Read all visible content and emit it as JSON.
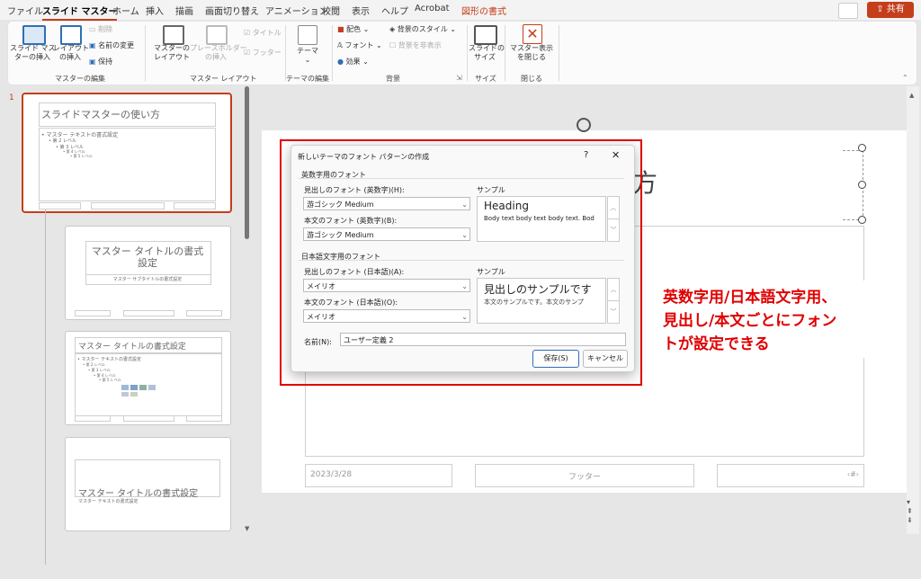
{
  "tabs": [
    "ファイル",
    "スライド マスター",
    "ホーム",
    "挿入",
    "描画",
    "画面切り替え",
    "アニメーション",
    "校閲",
    "表示",
    "ヘルプ",
    "Acrobat",
    "図形の書式"
  ],
  "share_label": "共有",
  "ribbon": {
    "insert_master": [
      "スライド マス",
      "ターの挿入"
    ],
    "insert_layout": [
      "レイアウト",
      "の挿入"
    ],
    "delete": "削除",
    "rename": "名前の変更",
    "preserve": "保持",
    "group_edit_master": "マスターの編集",
    "master_layout": [
      "マスターの",
      "レイアウト"
    ],
    "insert_placeholder": [
      "プレースホルダー",
      "の挿入"
    ],
    "title_check": "タイトル",
    "footer_check": "フッター",
    "group_master_layout": "マスター レイアウト",
    "theme": "テーマ",
    "group_edit_theme": "テーマの編集",
    "colors": "配色",
    "fonts": "フォント",
    "effects": "効果",
    "bg_style": "背景のスタイル",
    "hide_bg": "背景を非表示",
    "group_background": "背景",
    "slide_size": [
      "スライドの",
      "サイズ"
    ],
    "group_size": "サイズ",
    "close_master": [
      "マスター表示",
      "を閉じる"
    ],
    "group_close": "閉じる"
  },
  "thumbs": {
    "number": "1",
    "master_title": "スライドマスターの使い方",
    "master_levels": [
      "• マスター テキストの書式設定",
      "• 第 2 レベル",
      "• 第 3 レベル",
      "• 第 4 レベル",
      "• 第 5 レベル"
    ],
    "t2_title": "マスター タイトルの書式設定",
    "t2_sub": "マスター サブタイトルの書式設定",
    "t3_title": "マスター タイトルの書式設定",
    "t3_levels": [
      "• マスター テキストの書式設定",
      "• 第 2 レベル",
      "• 第 3 レベル",
      "• 第 4 レベル",
      "• 第 5 レベル"
    ],
    "t4_title": "マスター タイトルの書式設定",
    "t4_sub": "マスター テキストの書式設定"
  },
  "slide": {
    "title_visible": "方",
    "date": "2023/3/28",
    "footer": "フッター",
    "pagenum": "‹#›"
  },
  "dialog": {
    "title": "新しいテーマのフォント パターンの作成",
    "help": "?",
    "close": "✕",
    "latin_section": "英数字用のフォント",
    "latin_heading_label": "見出しのフォント (英数字)(H):",
    "latin_heading_value": "游ゴシック Medium",
    "latin_body_label": "本文のフォント (英数字)(B):",
    "latin_body_value": "游ゴシック Medium",
    "sample_label": "サンプル",
    "latin_sample_heading": "Heading",
    "latin_sample_body": "Body text body text body text. Bod",
    "ea_section": "日本語文字用のフォント",
    "ea_heading_label": "見出しのフォント (日本語)(A):",
    "ea_heading_value": "メイリオ",
    "ea_body_label": "本文のフォント (日本語)(O):",
    "ea_body_value": "メイリオ",
    "sample_label2": "サンプル",
    "ea_sample_heading": "見出しのサンプルです",
    "ea_sample_body": "本文のサンプルです。本文のサンプ",
    "name_label": "名前(N):",
    "name_value": "ユーザー定義 2",
    "save": "保存(S)",
    "cancel": "キャンセル"
  },
  "annotation": [
    "英数字用/日本語文字用、",
    "見出し/本文ごとにフォン",
    "トが設定できる"
  ],
  "colors": {
    "accent": "#c43e1c",
    "highlight": "#e00000"
  }
}
